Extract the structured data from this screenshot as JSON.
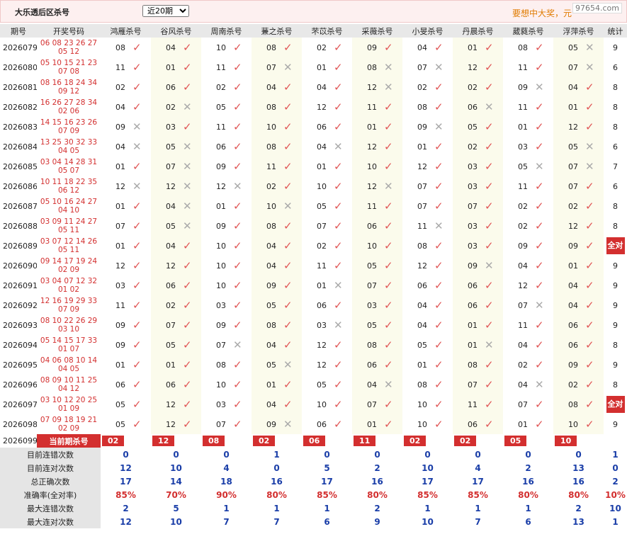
{
  "header": {
    "title": "大乐透后区杀号",
    "range_select": "近20期",
    "ad_text": "要想中大奖，元",
    "logo": "97654.com"
  },
  "columns": {
    "issue": "期号",
    "numbers": "开奖号码",
    "experts": [
      "鸿雁杀号",
      "谷风杀号",
      "周南杀号",
      "蒹之杀号",
      "芣苡杀号",
      "采薇杀号",
      "小旻杀号",
      "丹晨杀号",
      "葳蕤杀号",
      "浮萍杀号"
    ],
    "stat": "统计"
  },
  "rows": [
    {
      "issue": "2026079",
      "n1": "06 08 23 26 27",
      "n2": "05 12",
      "picks": [
        "08",
        "04",
        "10",
        "08",
        "02",
        "09",
        "04",
        "01",
        "08",
        "05"
      ],
      "res": [
        1,
        1,
        1,
        1,
        1,
        1,
        1,
        1,
        1,
        0
      ],
      "stat": "9"
    },
    {
      "issue": "2026080",
      "n1": "05 10 15 21 23",
      "n2": "07 08",
      "picks": [
        "11",
        "01",
        "11",
        "07",
        "01",
        "08",
        "07",
        "12",
        "11",
        "07"
      ],
      "res": [
        1,
        1,
        1,
        0,
        1,
        0,
        0,
        1,
        1,
        0
      ],
      "stat": "6"
    },
    {
      "issue": "2026081",
      "n1": "08 16 18 24 34",
      "n2": "09 12",
      "picks": [
        "02",
        "06",
        "02",
        "04",
        "04",
        "12",
        "02",
        "02",
        "09",
        "04"
      ],
      "res": [
        1,
        1,
        1,
        1,
        1,
        0,
        1,
        1,
        0,
        1
      ],
      "stat": "8"
    },
    {
      "issue": "2026082",
      "n1": "16 26 27 28 34",
      "n2": "02 06",
      "picks": [
        "04",
        "02",
        "05",
        "08",
        "12",
        "11",
        "08",
        "06",
        "11",
        "01"
      ],
      "res": [
        1,
        0,
        1,
        1,
        1,
        1,
        1,
        0,
        1,
        1
      ],
      "stat": "8"
    },
    {
      "issue": "2026083",
      "n1": "14 15 16 23 26",
      "n2": "07 09",
      "picks": [
        "09",
        "03",
        "11",
        "10",
        "06",
        "01",
        "09",
        "05",
        "01",
        "12"
      ],
      "res": [
        0,
        1,
        1,
        1,
        1,
        1,
        0,
        1,
        1,
        1
      ],
      "stat": "8"
    },
    {
      "issue": "2026084",
      "n1": "13 25 30 32 33",
      "n2": "04 05",
      "picks": [
        "04",
        "05",
        "06",
        "08",
        "04",
        "12",
        "01",
        "02",
        "03",
        "05"
      ],
      "res": [
        0,
        0,
        1,
        1,
        0,
        1,
        1,
        1,
        1,
        0
      ],
      "stat": "6"
    },
    {
      "issue": "2026085",
      "n1": "03 04 14 28 31",
      "n2": "05 07",
      "picks": [
        "01",
        "07",
        "09",
        "11",
        "01",
        "10",
        "12",
        "03",
        "05",
        "07"
      ],
      "res": [
        1,
        0,
        1,
        1,
        1,
        1,
        1,
        1,
        0,
        0
      ],
      "stat": "7"
    },
    {
      "issue": "2026086",
      "n1": "10 11 18 22 35",
      "n2": "06 12",
      "picks": [
        "12",
        "12",
        "12",
        "02",
        "10",
        "12",
        "07",
        "03",
        "11",
        "07"
      ],
      "res": [
        0,
        0,
        0,
        1,
        1,
        0,
        1,
        1,
        1,
        1
      ],
      "stat": "6"
    },
    {
      "issue": "2026087",
      "n1": "05 10 16 24 27",
      "n2": "04 10",
      "picks": [
        "01",
        "04",
        "01",
        "10",
        "05",
        "11",
        "07",
        "07",
        "02",
        "02"
      ],
      "res": [
        1,
        0,
        1,
        0,
        1,
        1,
        1,
        1,
        1,
        1
      ],
      "stat": "8"
    },
    {
      "issue": "2026088",
      "n1": "03 09 11 24 27",
      "n2": "05 11",
      "picks": [
        "07",
        "05",
        "09",
        "08",
        "07",
        "06",
        "11",
        "03",
        "02",
        "12"
      ],
      "res": [
        1,
        0,
        1,
        1,
        1,
        1,
        0,
        1,
        1,
        1
      ],
      "stat": "8"
    },
    {
      "issue": "2026089",
      "n1": "03 07 12 14 26",
      "n2": "05 11",
      "picks": [
        "01",
        "04",
        "10",
        "04",
        "02",
        "10",
        "08",
        "03",
        "09",
        "09"
      ],
      "res": [
        1,
        1,
        1,
        1,
        1,
        1,
        1,
        1,
        1,
        1
      ],
      "stat": "全对"
    },
    {
      "issue": "2026090",
      "n1": "09 14 17 19 24",
      "n2": "02 09",
      "picks": [
        "12",
        "12",
        "10",
        "04",
        "11",
        "05",
        "12",
        "09",
        "04",
        "01"
      ],
      "res": [
        1,
        1,
        1,
        1,
        1,
        1,
        1,
        0,
        1,
        1
      ],
      "stat": "9"
    },
    {
      "issue": "2026091",
      "n1": "03 04 07 12 32",
      "n2": "01 02",
      "picks": [
        "03",
        "06",
        "10",
        "09",
        "01",
        "07",
        "06",
        "06",
        "12",
        "04"
      ],
      "res": [
        1,
        1,
        1,
        1,
        0,
        1,
        1,
        1,
        1,
        1
      ],
      "stat": "9"
    },
    {
      "issue": "2026092",
      "n1": "12 16 19 29 33",
      "n2": "07 09",
      "picks": [
        "11",
        "02",
        "03",
        "05",
        "06",
        "03",
        "04",
        "06",
        "07",
        "04"
      ],
      "res": [
        1,
        1,
        1,
        1,
        1,
        1,
        1,
        1,
        0,
        1
      ],
      "stat": "9"
    },
    {
      "issue": "2026093",
      "n1": "08 10 22 26 29",
      "n2": "03 10",
      "picks": [
        "09",
        "07",
        "09",
        "08",
        "03",
        "05",
        "04",
        "01",
        "11",
        "06"
      ],
      "res": [
        1,
        1,
        1,
        1,
        0,
        1,
        1,
        1,
        1,
        1
      ],
      "stat": "9"
    },
    {
      "issue": "2026094",
      "n1": "05 14 15 17 33",
      "n2": "01 07",
      "picks": [
        "09",
        "05",
        "07",
        "04",
        "12",
        "08",
        "05",
        "01",
        "04",
        "06"
      ],
      "res": [
        1,
        1,
        0,
        1,
        1,
        1,
        1,
        0,
        1,
        1
      ],
      "stat": "8"
    },
    {
      "issue": "2026095",
      "n1": "04 06 08 10 14",
      "n2": "04 05",
      "picks": [
        "01",
        "01",
        "08",
        "05",
        "12",
        "06",
        "01",
        "08",
        "02",
        "09"
      ],
      "res": [
        1,
        1,
        1,
        0,
        1,
        1,
        1,
        1,
        1,
        1
      ],
      "stat": "9"
    },
    {
      "issue": "2026096",
      "n1": "08 09 10 11 25",
      "n2": "04 12",
      "picks": [
        "06",
        "06",
        "10",
        "01",
        "05",
        "04",
        "08",
        "07",
        "04",
        "02"
      ],
      "res": [
        1,
        1,
        1,
        1,
        1,
        0,
        1,
        1,
        0,
        1
      ],
      "stat": "8"
    },
    {
      "issue": "2026097",
      "n1": "03 10 12 20 25",
      "n2": "01 09",
      "picks": [
        "05",
        "12",
        "03",
        "04",
        "10",
        "07",
        "10",
        "11",
        "07",
        "08"
      ],
      "res": [
        1,
        1,
        1,
        1,
        1,
        1,
        1,
        1,
        1,
        1
      ],
      "stat": "全对"
    },
    {
      "issue": "2026098",
      "n1": "07 09 18 19 21",
      "n2": "02 09",
      "picks": [
        "05",
        "12",
        "07",
        "09",
        "06",
        "01",
        "10",
        "06",
        "01",
        "10"
      ],
      "res": [
        1,
        1,
        1,
        0,
        1,
        1,
        1,
        1,
        1,
        1
      ],
      "stat": "9"
    }
  ],
  "current": {
    "issue": "2026099",
    "label": "当前期杀号",
    "picks": [
      "02",
      "12",
      "08",
      "02",
      "06",
      "11",
      "02",
      "02",
      "05",
      "10"
    ]
  },
  "stats": [
    {
      "label": "目前连错次数",
      "values": [
        "0",
        "0",
        "0",
        "1",
        "0",
        "0",
        "0",
        "0",
        "0",
        "0",
        "1"
      ]
    },
    {
      "label": "目前连对次数",
      "values": [
        "12",
        "10",
        "4",
        "0",
        "5",
        "2",
        "10",
        "4",
        "2",
        "13",
        "0"
      ]
    },
    {
      "label": "总正确次数",
      "values": [
        "17",
        "14",
        "18",
        "16",
        "17",
        "16",
        "17",
        "17",
        "16",
        "16",
        "2"
      ]
    },
    {
      "label": "准确率(全对率)",
      "values": [
        "85%",
        "70%",
        "90%",
        "80%",
        "85%",
        "80%",
        "85%",
        "85%",
        "80%",
        "80%",
        "10%"
      ]
    },
    {
      "label": "最大连错次数",
      "values": [
        "2",
        "5",
        "1",
        "1",
        "1",
        "2",
        "1",
        "1",
        "1",
        "2",
        "10"
      ]
    },
    {
      "label": "最大连对次数",
      "values": [
        "12",
        "10",
        "7",
        "7",
        "6",
        "9",
        "10",
        "7",
        "6",
        "13",
        "1"
      ]
    }
  ],
  "colors": {
    "accent_red": "#d32f2f",
    "check": "#e05555",
    "cross": "#aaaaaa",
    "stat_blue": "#1a3ea8"
  },
  "icons": {
    "hit": "check-icon",
    "miss": "cross-icon"
  }
}
